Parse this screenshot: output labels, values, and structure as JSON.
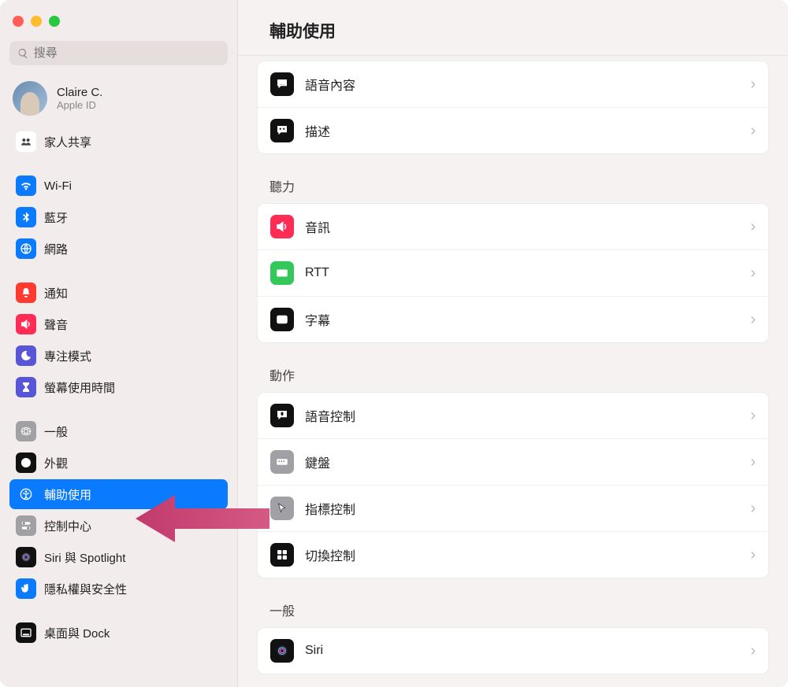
{
  "window": {
    "title": "輔助使用"
  },
  "search": {
    "placeholder": "搜尋"
  },
  "account": {
    "name": "Claire C.",
    "sub": "Apple ID"
  },
  "sidebar": {
    "items": [
      {
        "id": "family",
        "label": "家人共享",
        "iconBg": "#ffffff",
        "iconFg": "#444",
        "icon": "family"
      },
      {
        "id": "gap"
      },
      {
        "id": "wifi",
        "label": "Wi-Fi",
        "iconBg": "#0a7aff",
        "iconFg": "#fff",
        "icon": "wifi"
      },
      {
        "id": "bluetooth",
        "label": "藍牙",
        "iconBg": "#0a7aff",
        "iconFg": "#fff",
        "icon": "bluetooth"
      },
      {
        "id": "network",
        "label": "網路",
        "iconBg": "#0a7aff",
        "iconFg": "#fff",
        "icon": "globe"
      },
      {
        "id": "gap"
      },
      {
        "id": "notif",
        "label": "通知",
        "iconBg": "#ff3b30",
        "iconFg": "#fff",
        "icon": "bell"
      },
      {
        "id": "sound",
        "label": "聲音",
        "iconBg": "#ff2d55",
        "iconFg": "#fff",
        "icon": "speaker"
      },
      {
        "id": "focus",
        "label": "專注模式",
        "iconBg": "#5856d6",
        "iconFg": "#fff",
        "icon": "moon"
      },
      {
        "id": "screentime",
        "label": "螢幕使用時間",
        "iconBg": "#5856d6",
        "iconFg": "#fff",
        "icon": "hourglass"
      },
      {
        "id": "gap"
      },
      {
        "id": "general",
        "label": "一般",
        "iconBg": "#a0a0a5",
        "iconFg": "#fff",
        "icon": "gear"
      },
      {
        "id": "appearance",
        "label": "外觀",
        "iconBg": "#111",
        "iconFg": "#fff",
        "icon": "contrast"
      },
      {
        "id": "accessibility",
        "label": "輔助使用",
        "iconBg": "#0a7aff",
        "iconFg": "#fff",
        "icon": "accessibility",
        "selected": true
      },
      {
        "id": "control",
        "label": "控制中心",
        "iconBg": "#a0a0a5",
        "iconFg": "#fff",
        "icon": "switches"
      },
      {
        "id": "siri",
        "label": "Siri 與 Spotlight",
        "iconBg": "#111",
        "iconFg": "#fff",
        "icon": "siri"
      },
      {
        "id": "privacy",
        "label": "隱私權與安全性",
        "iconBg": "#0a7aff",
        "iconFg": "#fff",
        "icon": "hand"
      },
      {
        "id": "gap"
      },
      {
        "id": "desktop",
        "label": "桌面與 Dock",
        "iconBg": "#111",
        "iconFg": "#fff",
        "icon": "dock"
      }
    ]
  },
  "main": {
    "groups": [
      {
        "title": null,
        "rows": [
          {
            "id": "spoken",
            "label": "語音內容",
            "iconBg": "#111",
            "iconFg": "#fff",
            "icon": "speechbubble"
          },
          {
            "id": "desc",
            "label": "描述",
            "iconBg": "#111",
            "iconFg": "#fff",
            "icon": "descbubble"
          }
        ]
      },
      {
        "title": "聽力",
        "rows": [
          {
            "id": "audio",
            "label": "音訊",
            "iconBg": "#ff2d55",
            "iconFg": "#fff",
            "icon": "speaker"
          },
          {
            "id": "rtt",
            "label": "RTT",
            "iconBg": "#34c759",
            "iconFg": "#fff",
            "icon": "rtt"
          },
          {
            "id": "captions",
            "label": "字幕",
            "iconBg": "#111",
            "iconFg": "#fff",
            "icon": "captions"
          }
        ]
      },
      {
        "title": "動作",
        "rows": [
          {
            "id": "voicectl",
            "label": "語音控制",
            "iconBg": "#111",
            "iconFg": "#fff",
            "icon": "micbubble"
          },
          {
            "id": "keyboard",
            "label": "鍵盤",
            "iconBg": "#a0a0a5",
            "iconFg": "#fff",
            "icon": "keyboard"
          },
          {
            "id": "pointer",
            "label": "指標控制",
            "iconBg": "#a0a0a5",
            "iconFg": "#444",
            "icon": "cursor"
          },
          {
            "id": "switch",
            "label": "切換控制",
            "iconBg": "#111",
            "iconFg": "#fff",
            "icon": "grid"
          }
        ]
      },
      {
        "title": "一般",
        "rows": [
          {
            "id": "siri2",
            "label": "Siri",
            "iconBg": "#111",
            "iconFg": "#fff",
            "icon": "siri"
          }
        ]
      }
    ]
  },
  "annotation": {
    "arrowColor": "#c13a6b"
  }
}
